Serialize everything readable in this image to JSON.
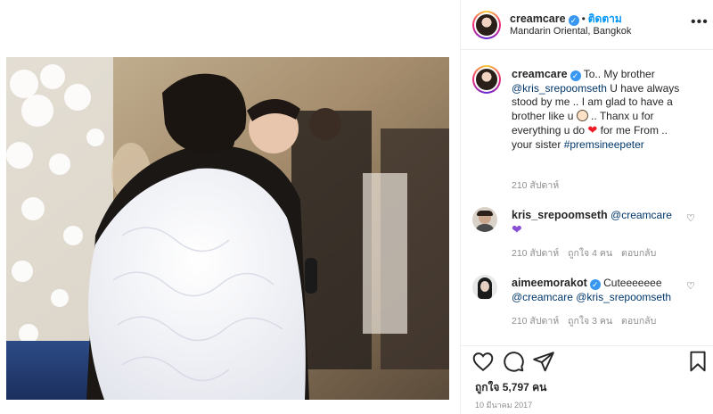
{
  "post": {
    "username": "creamcare",
    "follow_label": "ติดตาม",
    "location": "Mandarin Oriental, Bangkok",
    "caption": {
      "username": "creamcare",
      "line1": "To.. My brother",
      "mention": "@kris_srepoomseth",
      "line2": " U have always stood by me .. I am glad to have a brother like u",
      "line3": " .. Thanx u for everything u do ",
      "line4": " for me From .. your sister",
      "hashtag": "#premsineepeter",
      "time": "210 สัปดาห์"
    },
    "comments": [
      {
        "username": "kris_srepoomseth",
        "mention": "@creamcare",
        "time": "210 สัปดาห์",
        "likes": "ถูกใจ 4 คน",
        "reply": "ตอบกลับ"
      },
      {
        "username": "aimeemorakot",
        "text": "Cuteeeeeee",
        "mention1": "@creamcare",
        "mention2": "@kris_srepoomseth",
        "time": "210 สัปดาห์",
        "likes": "ถูกใจ 3 คน",
        "reply": "ตอบกลับ"
      }
    ],
    "likes": "ถูกใจ 5,797 คน",
    "date": "10 มีนาคม 2017"
  },
  "icons": {
    "more": "more-options-icon",
    "verified": "verified-badge-icon",
    "heart": "heart-icon",
    "comment": "comment-icon",
    "share": "share-icon",
    "save": "bookmark-icon"
  },
  "colors": {
    "link": "#00376b",
    "follow": "#0095f6",
    "verified": "#3897f0",
    "muted": "#8e8e8e",
    "purple_heart": "#8a4fd6",
    "red_heart": "#ed1c24"
  }
}
